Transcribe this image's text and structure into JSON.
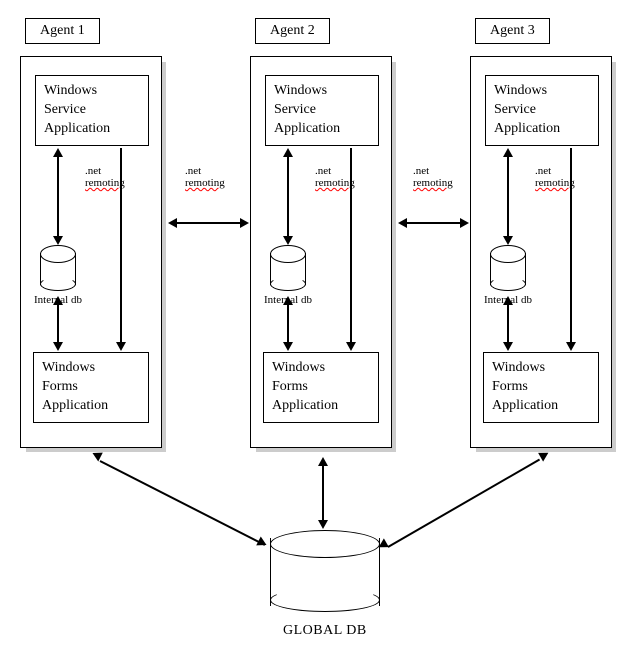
{
  "agents": [
    {
      "label": "Agent 1",
      "top_box": "Windows\nService\nApplication",
      "bottom_box": "Windows\nForms\nApplication",
      "db_label": "Internal db",
      "remoting": ".net\nremoting"
    },
    {
      "label": "Agent 2",
      "top_box": "Windows\nService\nApplication",
      "bottom_box": "Windows\nForms\nApplication",
      "db_label": "Internal db",
      "remoting": ".net\nremoting"
    },
    {
      "label": "Agent 3",
      "top_box": "Windows\nService\nApplication",
      "bottom_box": "Windows\nForms\nApplication",
      "db_label": "Internal db",
      "remoting": ".net\nremoting"
    }
  ],
  "between": [
    {
      "label": ".net\nremoting"
    },
    {
      "label": ".net\nremoting"
    }
  ],
  "global_db": {
    "label": "GLOBAL DB"
  }
}
